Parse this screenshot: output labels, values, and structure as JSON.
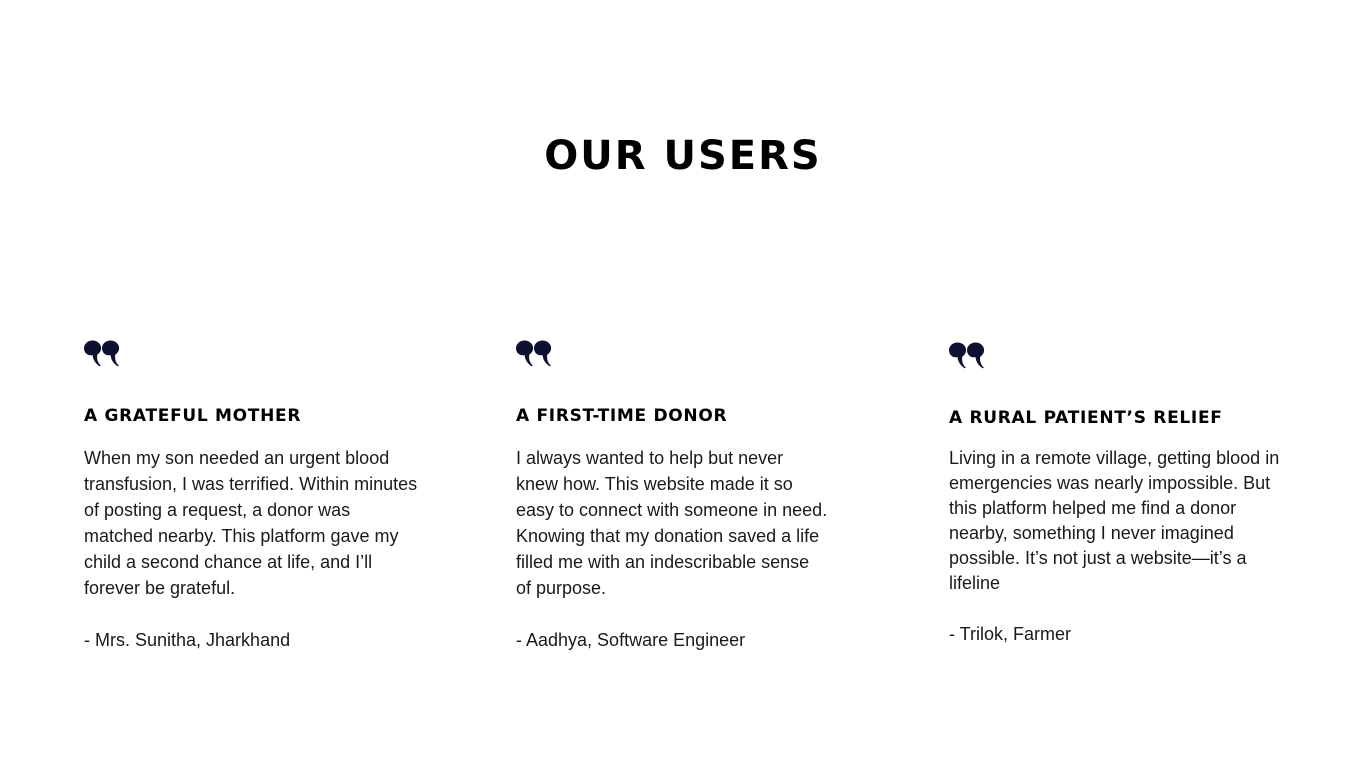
{
  "section": {
    "title": "OUR USERS"
  },
  "testimonials": [
    {
      "icon": "quote-icon",
      "title": "A GRATEFUL MOTHER",
      "body": "When my son needed an urgent blood transfusion, I was terrified. Within minutes of posting a request, a donor was matched nearby. This platform gave my child a second chance at life, and I’ll forever be grateful.",
      "author": "- Mrs. Sunitha, Jharkhand"
    },
    {
      "icon": "quote-icon",
      "title": "A FIRST-TIME DONOR",
      "body": "I always wanted to help but never knew how. This website made it so easy to connect with someone in need. Knowing that my donation saved a life filled me with an indescribable sense of purpose.",
      "author": "- Aadhya, Software Engineer"
    },
    {
      "icon": "quote-icon",
      "title": "A RURAL PATIENT’S RELIEF",
      "body": "Living in a remote village, getting blood in emergencies was nearly impossible. But this platform helped me find a donor nearby, something I never imagined possible. It’s not just a website—it’s a lifeline",
      "author": "- Trilok, Farmer"
    }
  ],
  "colors": {
    "icon": "#0d1030",
    "heading": "#000000",
    "text": "#1a1a1a"
  }
}
